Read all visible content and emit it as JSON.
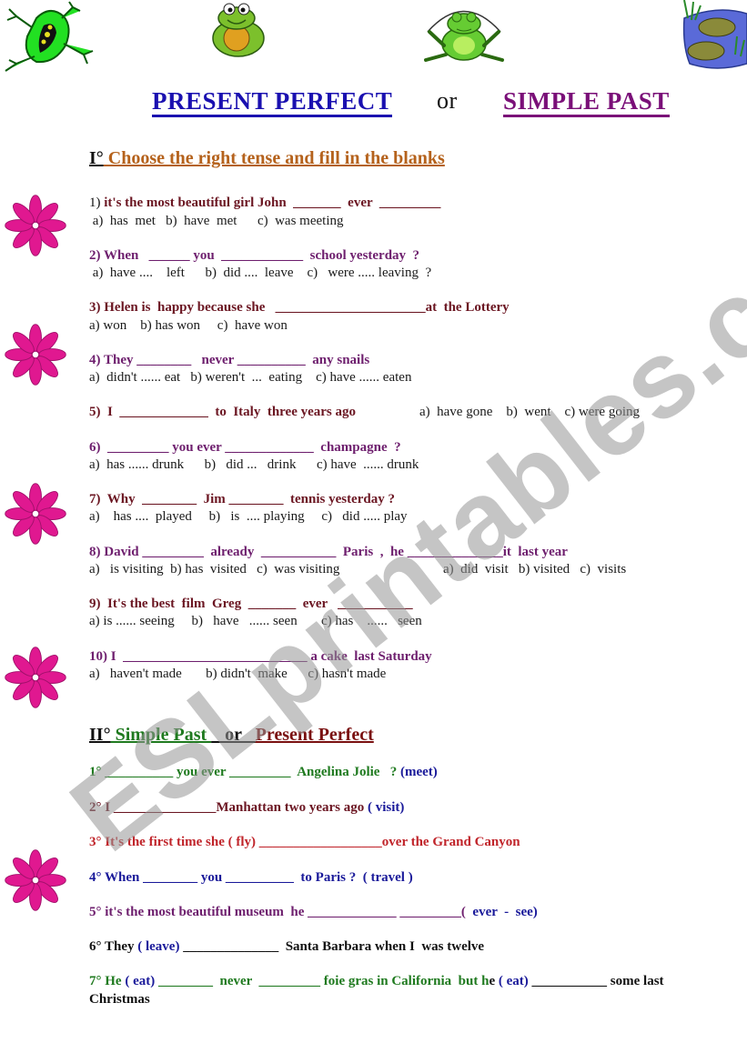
{
  "header": {
    "title_left": "PRESENT  PERFECT",
    "title_mid": "or",
    "title_right": "SIMPLE   PAST",
    "images": [
      "frog-icon",
      "frog-icon",
      "jumping-frog-icon",
      "frogs-in-pond-icon"
    ]
  },
  "section1": {
    "numeral": "I°",
    "heading": " Choose  the  right  tense  and fill  in the blanks ",
    "questions": [
      {
        "num": "1) ",
        "text": "it's the most beautiful girl John  _______  ever  _________",
        "options": " a)  has  met   b)  have  met      c)  was meeting"
      },
      {
        "num": "",
        "text": "2) When   ______ you  ____________  school yesterday  ?",
        "options": " a)  have ....    left      b)  did ....  leave    c)   were ..... leaving  ?"
      },
      {
        "num": "",
        "text": "3) Helen is  happy because she   ______________________at  the Lottery",
        "options": "a) won    b) has won     c)  have won"
      },
      {
        "num": "",
        "text": "4) They ________   never __________  any snails",
        "options": "a)  didn't ...... eat   b) weren't  ...  eating    c) have ...... eaten"
      },
      {
        "num": "",
        "text": "5)  I  _____________  to  Italy  three years ago",
        "options": "a)  have gone    b)  went    c) were going"
      },
      {
        "num": "",
        "text": "6)  _________ you ever _____________  champagne  ?",
        "options": "a)  has ...... drunk      b)   did ...   drink      c) have  ...... drunk"
      },
      {
        "num": "",
        "text": "7)  Why  ________  Jim ________  tennis yesterday ?",
        "options": "a)    has ....  played     b)   is  .... playing     c)   did ..... play"
      },
      {
        "num": "",
        "text": "8) David _________  already  ___________  Paris  ,  he ______________it  last year",
        "options": "a)   is visiting  b) has  visited   c)  was visiting",
        "options2": "a)  did  visit   b) visited   c)  visits"
      },
      {
        "num": "",
        "text": "9)  It's the best  film  Greg  _______  ever   ___________",
        "options": "a) is ...... seeing     b)   have   ...... seen       c) has    ......   seen"
      },
      {
        "num": "",
        "text": "10) I  ___________________________ a cake  last Saturday",
        "options": "a)   haven't made       b) didn't  make      c) hasn't made"
      }
    ]
  },
  "section2": {
    "numeral": "II°",
    "heading_a": " Simple Past ",
    "heading_or": "   or   ",
    "heading_b": "Present Perfect ",
    "items": [
      {
        "text": "1° __________ you ever _________  Angelina Jolie   ? ",
        "hint": "(meet)"
      },
      {
        "text": "2° I _______________Manhattan two years ago ",
        "hint": "( visit)"
      },
      {
        "text": "3° It's the first time she ( fly) __________________over the Grand Canyon",
        "hint": ""
      },
      {
        "text": "4° When ________ you __________  to Paris ?  ",
        "hint": "( travel )"
      },
      {
        "text": "5° it's the most beautiful museum  he _____________ _________(  ",
        "hint": "ever  -  see)"
      },
      {
        "text_a": "6° They ",
        "hint": "( leave)",
        "text_b": " ______________  Santa Barbara when I  was twelve"
      },
      {
        "text_a": "7° He ",
        "hint_a": "( eat)",
        "text_b": " ________  never  _________ foie gras in California  but h",
        "text_c": "e ",
        "hint_b": "( eat)",
        "text_d": " ___________ some last",
        "text_e": "Christmas"
      }
    ]
  },
  "watermark": "ESLprintables.com"
}
